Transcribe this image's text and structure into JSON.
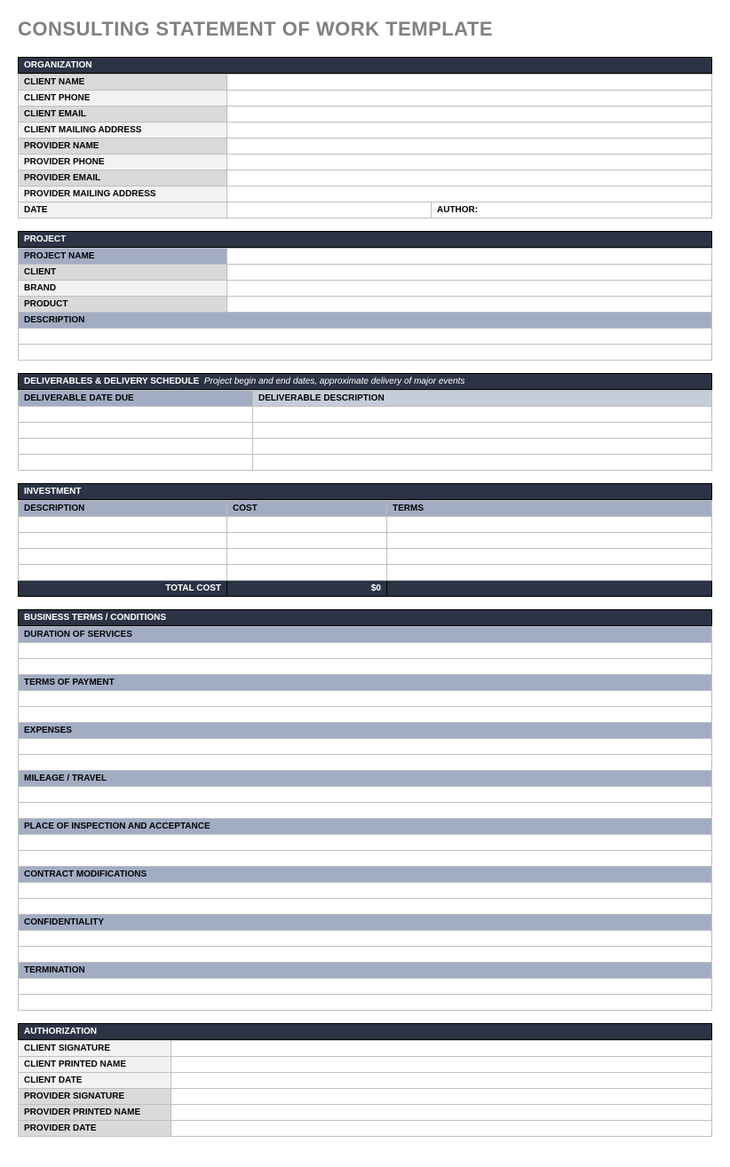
{
  "title": "CONSULTING STATEMENT OF WORK TEMPLATE",
  "organization": {
    "header": "ORGANIZATION",
    "rows": {
      "client_name": "CLIENT NAME",
      "client_phone": "CLIENT  PHONE",
      "client_email": "CLIENT EMAIL",
      "client_mailing": "CLIENT MAILING ADDRESS",
      "provider_name": "PROVIDER NAME",
      "provider_phone": "PROVIDER PHONE",
      "provider_email": "PROVIDER EMAIL",
      "provider_mailing": "PROVIDER MAILING ADDRESS",
      "date": "DATE",
      "author": "AUTHOR:"
    }
  },
  "project": {
    "header": "PROJECT",
    "rows": {
      "project_name": "PROJECT NAME",
      "client": "CLIENT",
      "brand": "BRAND",
      "product": "PRODUCT",
      "description": "DESCRIPTION"
    }
  },
  "deliverables": {
    "header": "DELIVERABLES & DELIVERY SCHEDULE",
    "note": "Project begin and end dates, approximate delivery of major events",
    "cols": {
      "due": "DELIVERABLE DATE DUE",
      "desc": "DELIVERABLE DESCRIPTION"
    }
  },
  "investment": {
    "header": "INVESTMENT",
    "cols": {
      "desc": "DESCRIPTION",
      "cost": "COST",
      "terms": "TERMS"
    },
    "total_label": "TOTAL COST",
    "total_value": "$0"
  },
  "business_terms": {
    "header": "BUSINESS TERMS / CONDITIONS",
    "items": {
      "duration": "DURATION OF SERVICES",
      "terms_payment": "TERMS OF PAYMENT",
      "expenses": "EXPENSES",
      "mileage": "MILEAGE / TRAVEL",
      "place": "PLACE OF INSPECTION AND ACCEPTANCE",
      "contract_mod": "CONTRACT MODIFICATIONS",
      "confidentiality": "CONFIDENTIALITY",
      "termination": "TERMINATION"
    }
  },
  "authorization": {
    "header": "AUTHORIZATION",
    "rows": {
      "client_sig": "CLIENT SIGNATURE",
      "client_printed": "CLIENT PRINTED NAME",
      "client_date": "CLIENT DATE",
      "provider_sig": "PROVIDER SIGNATURE",
      "provider_printed": "PROVIDER PRINTED NAME",
      "provider_date": "PROVIDER DATE"
    }
  }
}
